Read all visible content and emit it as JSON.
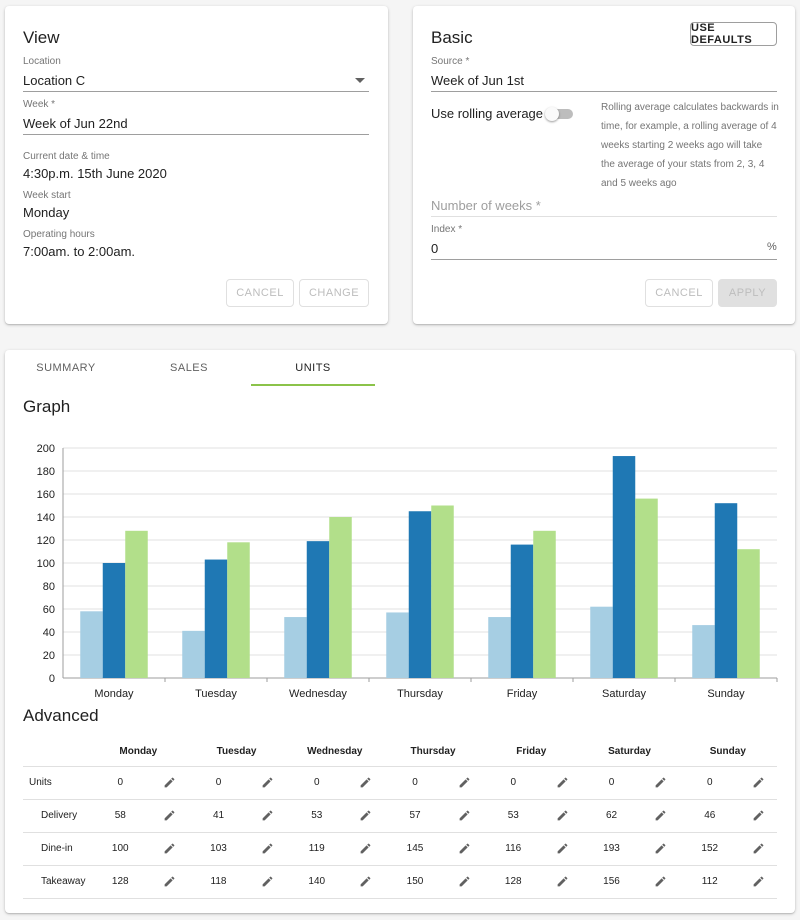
{
  "view": {
    "title": "View",
    "location_label": "Location",
    "location_value": "Location C",
    "week_label": "Week *",
    "week_value": "Week of Jun 22nd",
    "current_label": "Current date & time",
    "current_value": "4:30p.m. 15th June 2020",
    "week_start_label": "Week start",
    "week_start_value": "Monday",
    "hours_label": "Operating hours",
    "hours_value": "7:00am. to 2:00am.",
    "cancel": "CANCEL",
    "change": "CHANGE"
  },
  "basic": {
    "title": "Basic",
    "use_defaults": "USE DEFAULTS",
    "source_label": "Source *",
    "source_value": "Week of Jun 1st",
    "rolling_label": "Use rolling average",
    "rolling_on": false,
    "help_lines": [
      "Rolling average calculates backwards in",
      "time, for example, a rolling average of 4",
      "weeks starting 2 weeks ago will take",
      "the average of your stats from 2, 3, 4",
      "and 5 weeks ago"
    ],
    "weeks_placeholder": "Number of weeks *",
    "index_label": "Index *",
    "index_value": "0",
    "index_unit": "%",
    "cancel": "CANCEL",
    "apply": "APPLY"
  },
  "tabs": [
    "SUMMARY",
    "SALES",
    "UNITS"
  ],
  "active_tab": 2,
  "graph_title": "Graph",
  "advanced_title": "Advanced",
  "colors": {
    "delivery": "#a6cee3",
    "dinein": "#1f78b4",
    "takeaway": "#b2df8a",
    "accent": "#8bc34a"
  },
  "chart_data": {
    "type": "bar",
    "categories": [
      "Monday",
      "Tuesday",
      "Wednesday",
      "Thursday",
      "Friday",
      "Saturday",
      "Sunday"
    ],
    "series": [
      {
        "values": [
          58,
          41,
          53,
          57,
          53,
          62,
          46
        ]
      },
      {
        "values": [
          100,
          103,
          119,
          145,
          116,
          193,
          152
        ]
      },
      {
        "values": [
          128,
          118,
          140,
          150,
          128,
          156,
          112
        ]
      }
    ],
    "ylim": [
      0,
      200
    ],
    "yticks": [
      0,
      20,
      40,
      60,
      80,
      100,
      120,
      140,
      160,
      180,
      200
    ],
    "grid": true
  },
  "table": {
    "days": [
      "Monday",
      "Tuesday",
      "Wednesday",
      "Thursday",
      "Friday",
      "Saturday",
      "Sunday"
    ],
    "rows": [
      {
        "label": "Units",
        "sub": false,
        "values": [
          "0",
          "0",
          "0",
          "0",
          "0",
          "0",
          "0"
        ]
      },
      {
        "label": "Delivery",
        "sub": true,
        "values": [
          "58",
          "41",
          "53",
          "57",
          "53",
          "62",
          "46"
        ]
      },
      {
        "label": "Dine-in",
        "sub": true,
        "values": [
          "100",
          "103",
          "119",
          "145",
          "116",
          "193",
          "152"
        ]
      },
      {
        "label": "Takeaway",
        "sub": true,
        "values": [
          "128",
          "118",
          "140",
          "150",
          "128",
          "156",
          "112"
        ]
      }
    ],
    "edit_icon": "pencil-icon"
  }
}
